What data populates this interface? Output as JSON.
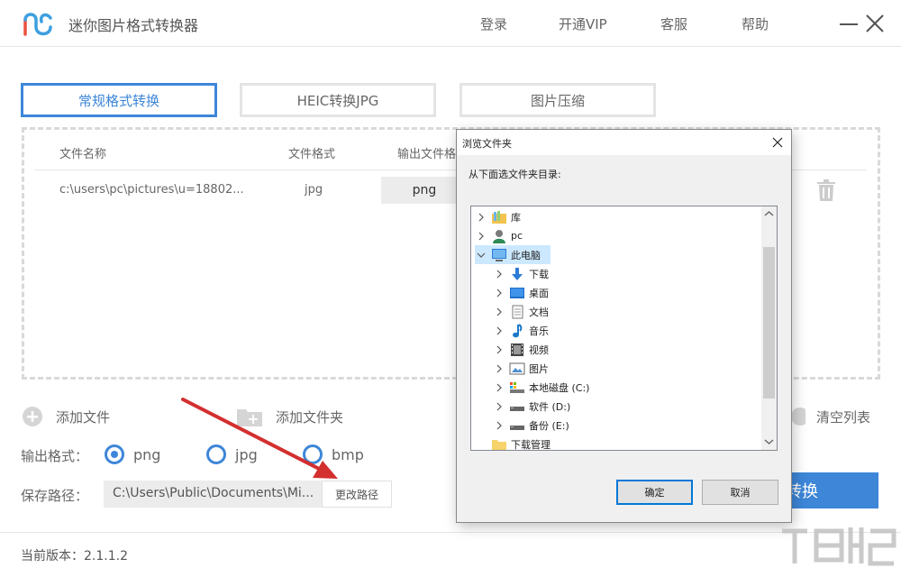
{
  "app": {
    "title": "迷你图片格式转换器"
  },
  "nav": {
    "login": "登录",
    "vip": "开通VIP",
    "service": "客服",
    "help": "帮助"
  },
  "tabs": [
    {
      "label": "常规格式转换",
      "active": true
    },
    {
      "label": "HEIC转换JPG",
      "active": false
    },
    {
      "label": "图片压缩",
      "active": false
    }
  ],
  "table": {
    "headers": {
      "name": "文件名称",
      "format": "文件格式",
      "output": "输出文件格"
    },
    "rows": [
      {
        "name": "c:\\users\\pc\\pictures\\u=18802...",
        "format": "jpg",
        "output": "png"
      }
    ]
  },
  "actions": {
    "add_file": "添加文件",
    "add_folder": "添加文件夹",
    "clear_list": "清空列表"
  },
  "output": {
    "label": "输出格式：",
    "options": [
      {
        "label": "png",
        "selected": true
      },
      {
        "label": "jpg",
        "selected": false
      },
      {
        "label": "bmp",
        "selected": false
      }
    ]
  },
  "save": {
    "label": "保存路径：",
    "path": "C:\\Users\\Public\\Documents\\Mi...",
    "change": "更改路径"
  },
  "convert": {
    "label": "转换"
  },
  "footer": {
    "version": "当前版本：2.1.1.2"
  },
  "dialog": {
    "title": "浏览文件夹",
    "instruction": "从下面选文件夹目录:",
    "tree": [
      {
        "label": "库",
        "icon": "library-icon",
        "level": 0,
        "expanded": false
      },
      {
        "label": "pc",
        "icon": "user-icon",
        "level": 0,
        "expanded": false
      },
      {
        "label": "此电脑",
        "icon": "computer-icon",
        "level": 0,
        "expanded": true,
        "selected": true
      },
      {
        "label": "下载",
        "icon": "download-icon",
        "level": 1,
        "expanded": false
      },
      {
        "label": "桌面",
        "icon": "desktop-icon",
        "level": 1,
        "expanded": false
      },
      {
        "label": "文档",
        "icon": "document-icon",
        "level": 1,
        "expanded": false
      },
      {
        "label": "音乐",
        "icon": "music-icon",
        "level": 1,
        "expanded": false
      },
      {
        "label": "视频",
        "icon": "video-icon",
        "level": 1,
        "expanded": false
      },
      {
        "label": "图片",
        "icon": "picture-icon",
        "level": 1,
        "expanded": false
      },
      {
        "label": "本地磁盘 (C:)",
        "icon": "drive-c-icon",
        "level": 1,
        "expanded": false
      },
      {
        "label": "软件 (D:)",
        "icon": "drive-icon",
        "level": 1,
        "expanded": false
      },
      {
        "label": "备份 (E:)",
        "icon": "drive-icon",
        "level": 1,
        "expanded": false
      },
      {
        "label": "下载管理",
        "icon": "folder-icon",
        "level": 0,
        "expanded": null
      }
    ],
    "ok": "确定",
    "cancel": "取消"
  },
  "colors": {
    "accent": "#3d86d8",
    "arrow": "#d32f2f"
  }
}
